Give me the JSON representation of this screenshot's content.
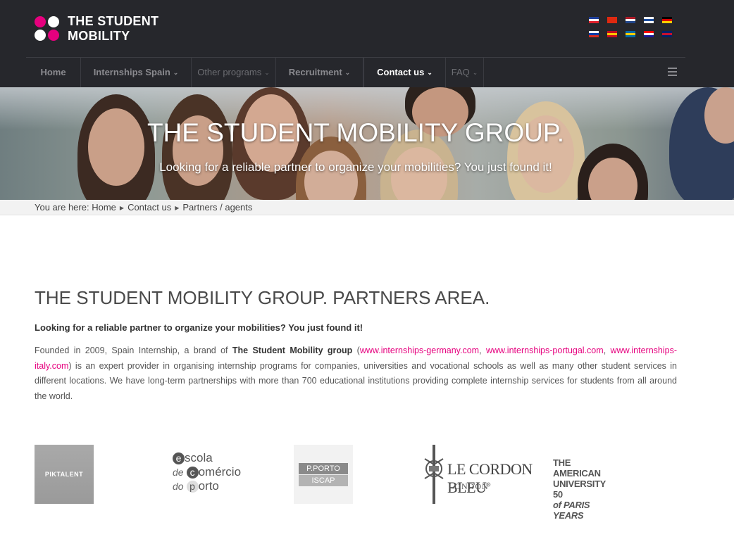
{
  "header": {
    "logo_line1": "THE STUDENT",
    "logo_line2": "MOBILITY",
    "flags": [
      {
        "name": "france-flag",
        "colors": [
          "#1f3f9a",
          "#ffffff",
          "#e0202c"
        ]
      },
      {
        "name": "china-flag",
        "colors": [
          "#de2910",
          "#de2910",
          "#de2910"
        ]
      },
      {
        "name": "netherlands-flag",
        "colors": [
          "#ae1c28",
          "#ffffff",
          "#21468b"
        ]
      },
      {
        "name": "finland-flag",
        "colors": [
          "#ffffff",
          "#1d4fa0",
          "#ffffff"
        ]
      },
      {
        "name": "germany-flag",
        "colors": [
          "#000000",
          "#dd0000",
          "#ffce00"
        ]
      },
      {
        "name": "russia-flag",
        "colors": [
          "#ffffff",
          "#0039a6",
          "#d52b1e"
        ]
      },
      {
        "name": "spain-flag",
        "colors": [
          "#c60b1e",
          "#ffc400",
          "#c60b1e"
        ]
      },
      {
        "name": "sweden-flag",
        "colors": [
          "#006aa7",
          "#fecc00",
          "#006aa7"
        ]
      },
      {
        "name": "croatia-flag",
        "colors": [
          "#ff0000",
          "#ffffff",
          "#171796"
        ]
      },
      {
        "name": "uk-flag",
        "colors": [
          "#012169",
          "#c8102e",
          "#012169"
        ]
      }
    ]
  },
  "nav": {
    "items": [
      {
        "label": "Home"
      },
      {
        "label": "Internships Spain"
      },
      {
        "label": "Other programs"
      },
      {
        "label": "Recruitment"
      },
      {
        "label": "Contact us"
      },
      {
        "label": "FAQ"
      }
    ]
  },
  "hero": {
    "title": "THE STUDENT MOBILITY GROUP.",
    "subtitle": "Looking for a reliable partner to organize your mobilities? You just found it!"
  },
  "breadcrumb": {
    "prefix": "You are here:",
    "items": [
      "Home",
      "Contact us",
      "Partners / agents"
    ]
  },
  "content": {
    "title": "THE STUDENT MOBILITY GROUP. PARTNERS AREA.",
    "lead": "Looking for a reliable partner to organize your mobilities? You just found it!",
    "para_1": "Founded in 2009, Spain Internship, a brand of ",
    "para_brand": "The Student Mobility group",
    "para_2": " (",
    "link_1": "www.internships-germany.com",
    "para_3": ", ",
    "link_2": "www.internships-portugal.com",
    "para_4": ", ",
    "link_3": "www.internships-italy.com",
    "para_5": ") is an expert provider in organising internship programs for companies, universities and vocational schools as well as many other student services in different locations. We have long-term partnerships with more than 700 educational institutions providing complete internship services for students from all around the world."
  },
  "partners": {
    "piktalent": "PIKTALENT",
    "escola": {
      "e": "e",
      "w1": "scola",
      "de": "de",
      "c": "c",
      "w2": "omércio",
      "do": "do",
      "p": "p",
      "w3": "orto"
    },
    "pporto": {
      "top": "P.PORTO",
      "bottom": "ISCAP"
    },
    "cordon": {
      "name": "LE CORDON BLEU",
      "reg": "®",
      "city": "LONDON"
    },
    "aup": {
      "l1": "THE AMERICAN",
      "l2": "UNIVERSITY 50",
      "l3": "of PARIS YEARS"
    }
  }
}
